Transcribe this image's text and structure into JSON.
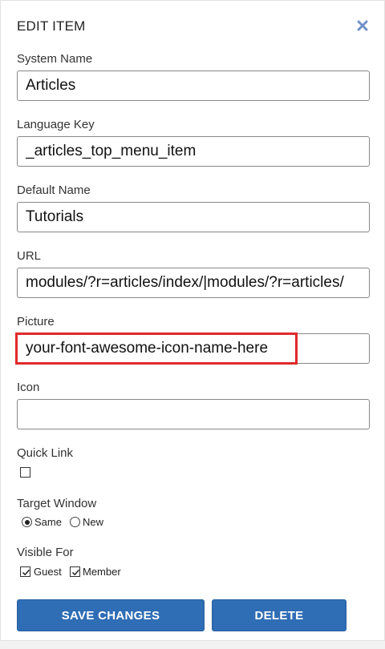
{
  "dialog": {
    "title": "EDIT ITEM",
    "close_icon": "close-x-icon"
  },
  "fields": {
    "system_name": {
      "label": "System Name",
      "value": "Articles"
    },
    "language_key": {
      "label": "Language Key",
      "value": "_articles_top_menu_item"
    },
    "default_name": {
      "label": "Default Name",
      "value": "Tutorials"
    },
    "url": {
      "label": "URL",
      "value": "modules/?r=articles/index/|modules/?r=articles/"
    },
    "picture": {
      "label": "Picture",
      "value": "your-font-awesome-icon-name-here"
    },
    "icon": {
      "label": "Icon",
      "value": ""
    }
  },
  "quick_link": {
    "label": "Quick Link",
    "checked": false
  },
  "target_window": {
    "label": "Target Window",
    "options": [
      {
        "label": "Same",
        "selected": true
      },
      {
        "label": "New",
        "selected": false
      }
    ]
  },
  "visible_for": {
    "label": "Visible For",
    "options": [
      {
        "label": "Guest",
        "checked": true
      },
      {
        "label": "Member",
        "checked": true
      }
    ]
  },
  "buttons": {
    "save_label": "SAVE CHANGES",
    "delete_label": "DELETE"
  },
  "colors": {
    "primary_button": "#2f6db5",
    "highlight_border": "#e02a2a",
    "close_icon": "#6f8fc9"
  }
}
